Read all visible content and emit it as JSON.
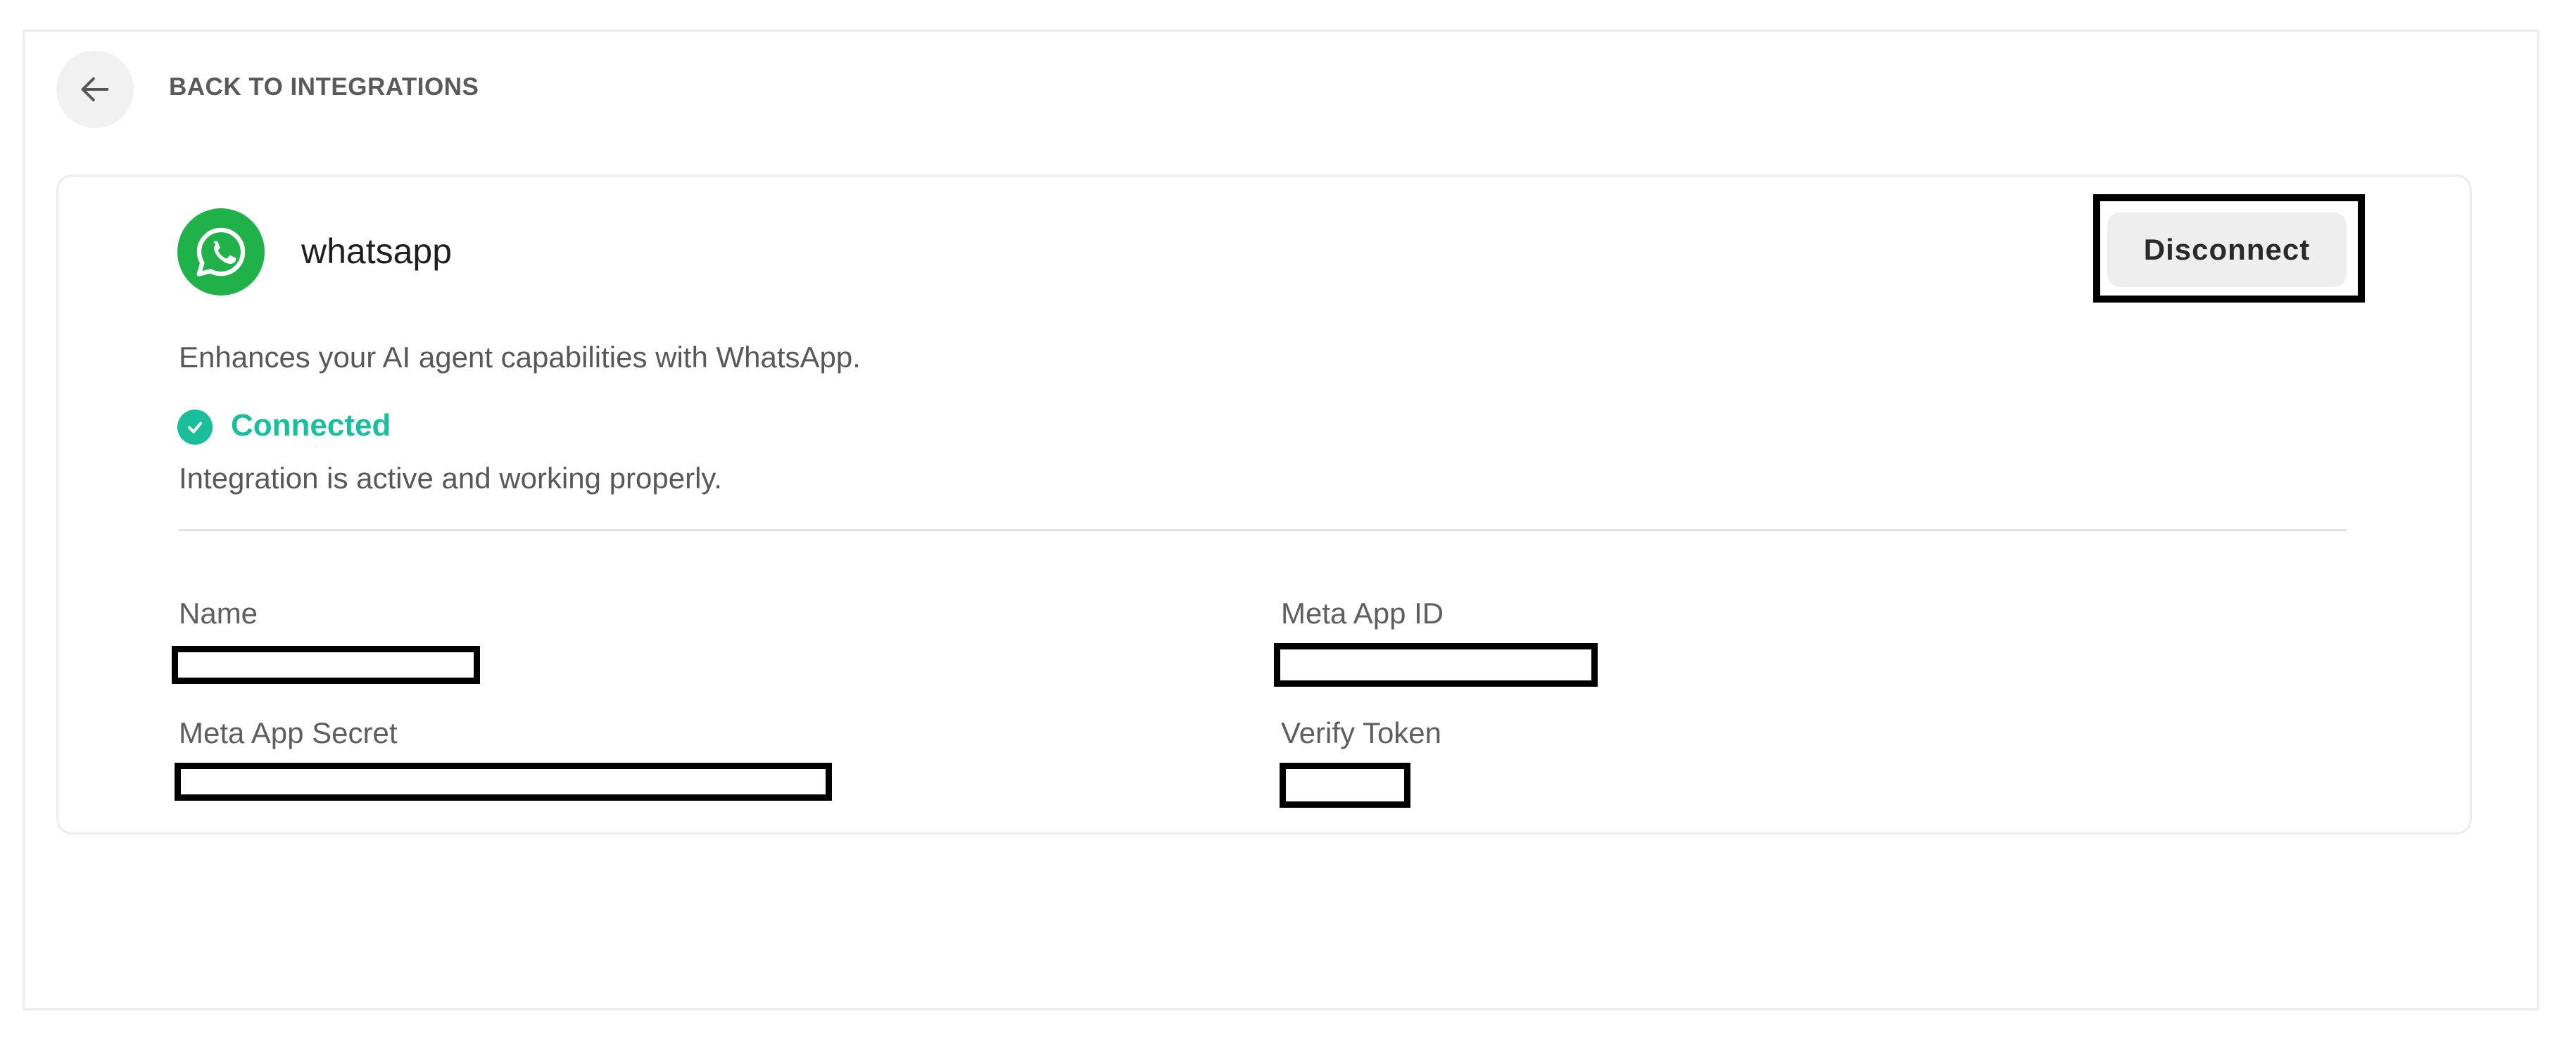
{
  "header": {
    "back_label": "BACK TO INTEGRATIONS",
    "back_icon": "arrow-left-icon"
  },
  "integration": {
    "name": "whatsapp",
    "logo_icon": "whatsapp-logo-icon",
    "description": "Enhances your AI agent capabilities with WhatsApp.",
    "disconnect_label": "Disconnect",
    "status": {
      "label": "Connected",
      "detail": "Integration is active and working properly.",
      "icon": "check-circle-icon",
      "color": "#19bf9a"
    },
    "fields": {
      "name": {
        "label": "Name",
        "value": ""
      },
      "meta_app_id": {
        "label": "Meta App ID",
        "value": ""
      },
      "meta_app_secret": {
        "label": "Meta App Secret",
        "value": ""
      },
      "verify_token": {
        "label": "Verify Token",
        "value": ""
      }
    }
  },
  "colors": {
    "accent_green": "#19bf9a",
    "whatsapp_green": "#21b14a",
    "button_bg": "#eeeeee"
  }
}
